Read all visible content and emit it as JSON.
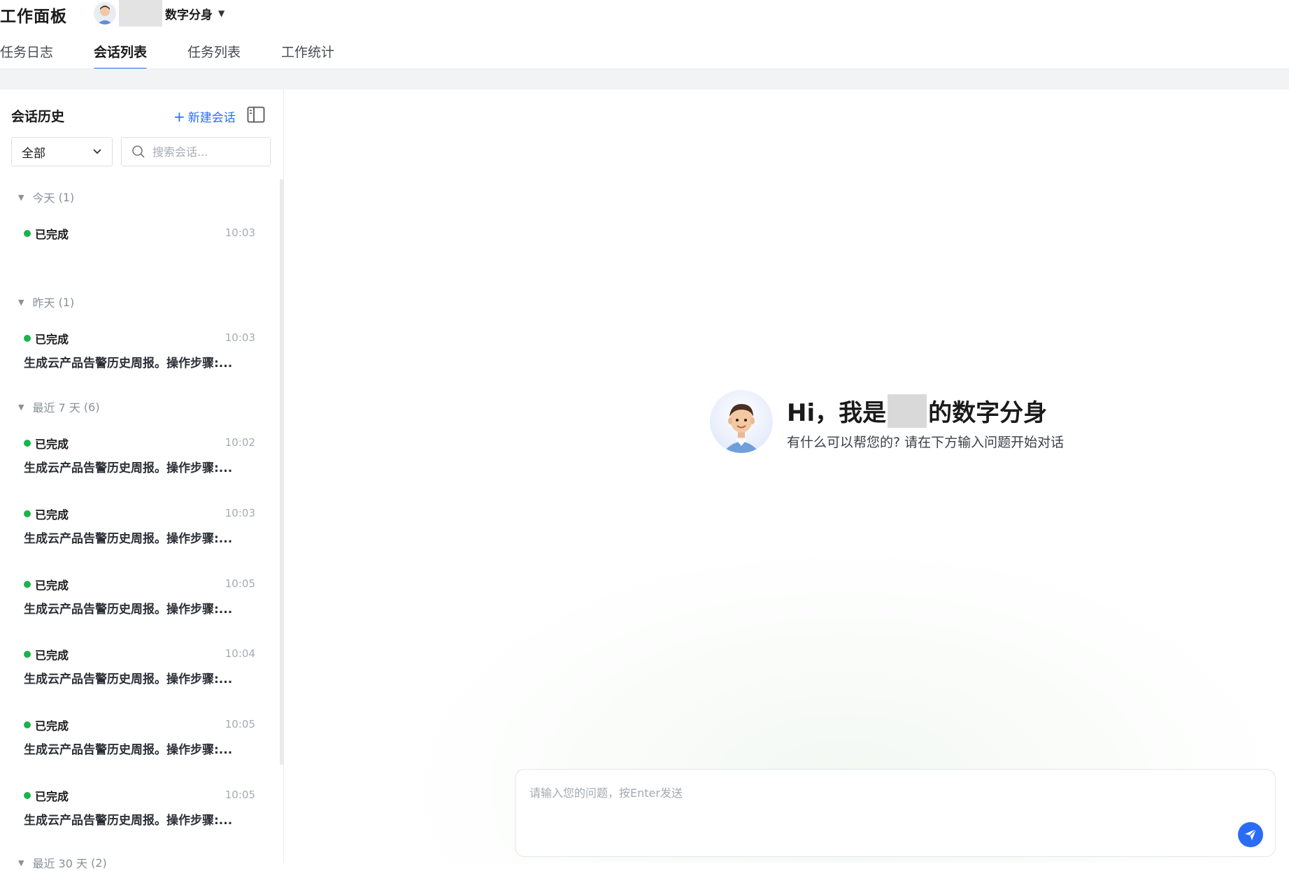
{
  "header": {
    "app_title": "工作面板",
    "persona_name": "数字分身",
    "tabs": [
      {
        "label": "任务日志"
      },
      {
        "label": "会话列表"
      },
      {
        "label": "任务列表"
      },
      {
        "label": "工作统计"
      }
    ],
    "active_tab": "会话列表"
  },
  "sidebar": {
    "title": "会话历史",
    "new_chat_label": "新建会话",
    "filter_value": "全部",
    "search_placeholder": "搜索会话...",
    "groups": [
      {
        "label": "今天",
        "count": "(1)"
      },
      {
        "label": "昨天",
        "count": "(1)"
      },
      {
        "label": "最近 7 天",
        "count": "(6)"
      },
      {
        "label": "最近 30 天",
        "count": "(2)"
      }
    ],
    "items": [
      {
        "status": "已完成",
        "time": "10:03",
        "desc": ""
      },
      {
        "status": "已完成",
        "time": "10:03",
        "desc": "生成云产品告警历史周报。操作步骤:..."
      },
      {
        "status": "已完成",
        "time": "10:02",
        "desc": "生成云产品告警历史周报。操作步骤:..."
      },
      {
        "status": "已完成",
        "time": "10:03",
        "desc": "生成云产品告警历史周报。操作步骤:..."
      },
      {
        "status": "已完成",
        "time": "10:05",
        "desc": "生成云产品告警历史周报。操作步骤:..."
      },
      {
        "status": "已完成",
        "time": "10:04",
        "desc": "生成云产品告警历史周报。操作步骤:..."
      },
      {
        "status": "已完成",
        "time": "10:05",
        "desc": "生成云产品告警历史周报。操作步骤:..."
      },
      {
        "status": "已完成",
        "time": "10:05",
        "desc": "生成云产品告警历史周报。操作步骤:..."
      }
    ]
  },
  "main": {
    "greeting_prefix": "Hi，我是",
    "greeting_suffix": "的数字分身",
    "greeting_sub": "有什么可以帮您的? 请在下方输入问题开始对话",
    "input_placeholder": "请输入您的问题，按Enter发送"
  },
  "colors": {
    "accent": "#2a6cf6",
    "status_done": "#19b34a"
  }
}
